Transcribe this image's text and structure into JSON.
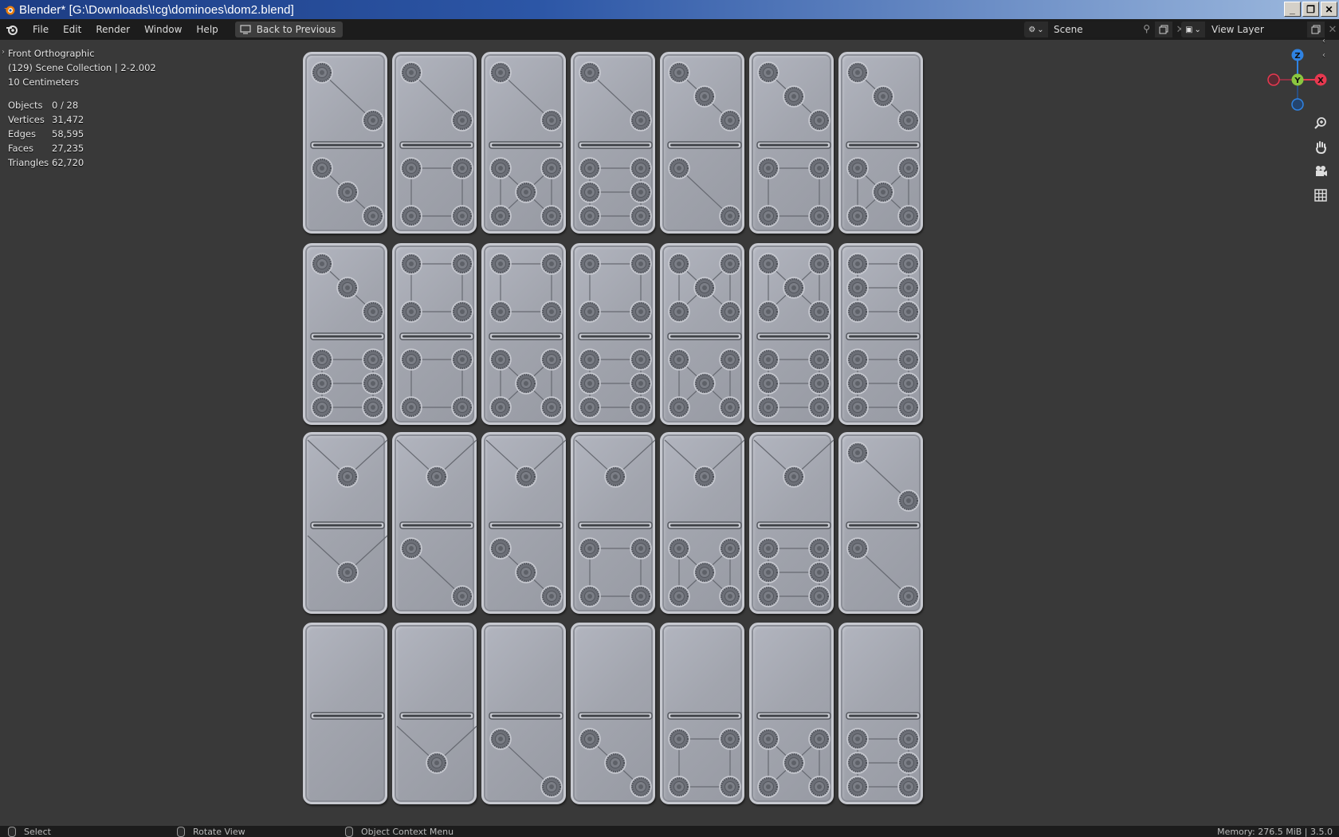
{
  "window": {
    "title": "Blender* [G:\\Downloads\\!cg\\dominoes\\dom2.blend]"
  },
  "menu": {
    "items": [
      "File",
      "Edit",
      "Render",
      "Window",
      "Help"
    ],
    "back_button": "Back to Previous"
  },
  "scene_selector": {
    "value": "Scene"
  },
  "view_layer_selector": {
    "value": "View Layer"
  },
  "viewport": {
    "view_name": "Front Orthographic",
    "collection": "(129) Scene Collection | 2-2.002",
    "scale": "10 Centimeters",
    "stats": [
      {
        "label": "Objects",
        "value": "0 / 28"
      },
      {
        "label": "Vertices",
        "value": "31,472"
      },
      {
        "label": "Edges",
        "value": "58,595"
      },
      {
        "label": "Faces",
        "value": "27,235"
      },
      {
        "label": "Triangles",
        "value": "62,720"
      }
    ],
    "gizmo_axes": {
      "z": "Z",
      "y": "Y",
      "x": "X"
    },
    "gizmo_colors": {
      "x": "#e8384f",
      "y": "#8bc63f",
      "z": "#2f83e3"
    }
  },
  "dominoes": [
    [
      [
        2,
        3
      ],
      [
        2,
        4
      ],
      [
        2,
        5
      ],
      [
        2,
        6
      ],
      [
        3,
        2
      ],
      [
        3,
        4
      ],
      [
        3,
        5
      ]
    ],
    [
      [
        3,
        6
      ],
      [
        4,
        4
      ],
      [
        4,
        5
      ],
      [
        4,
        6
      ],
      [
        5,
        5
      ],
      [
        5,
        6
      ],
      [
        6,
        6
      ]
    ],
    [
      [
        1,
        1
      ],
      [
        1,
        2
      ],
      [
        1,
        3
      ],
      [
        1,
        4
      ],
      [
        1,
        5
      ],
      [
        1,
        6
      ],
      [
        2,
        2
      ]
    ],
    [
      [
        0,
        0
      ],
      [
        0,
        1
      ],
      [
        0,
        2
      ],
      [
        0,
        3
      ],
      [
        0,
        4
      ],
      [
        0,
        5
      ],
      [
        0,
        6
      ]
    ]
  ],
  "statusbar": {
    "select": "Select",
    "rotate": "Rotate View",
    "context": "Object Context Menu",
    "memory": "Memory: 276.5 MiB | 3.5.0"
  }
}
